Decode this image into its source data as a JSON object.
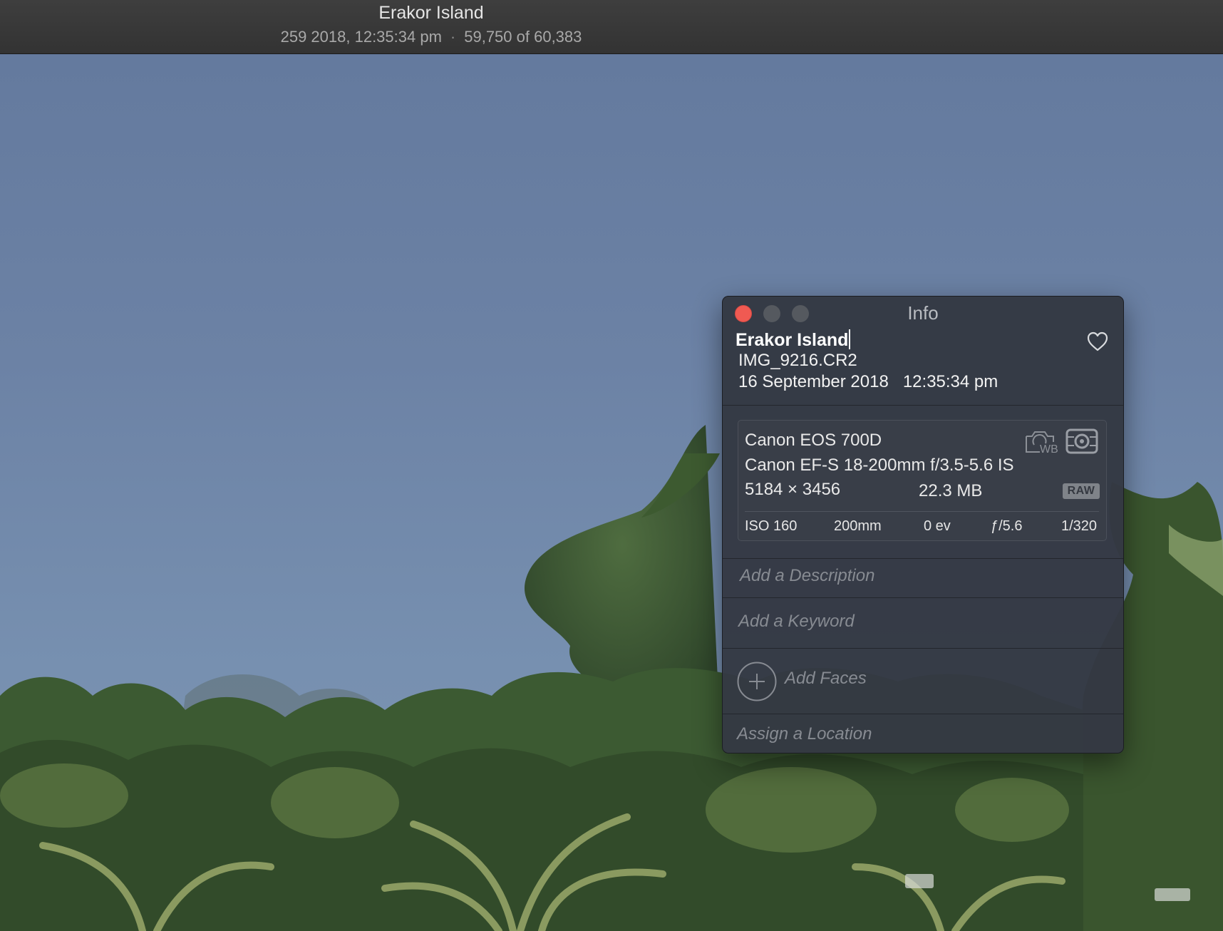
{
  "window": {
    "title": "Erakor Island",
    "subtitle_date": "259 2018, 12:35:34 pm",
    "subtitle_separator": "·",
    "subtitle_position": "59,750 of 60,383"
  },
  "info_panel": {
    "title": "Info",
    "photo_title": "Erakor Island",
    "file_name": "IMG_9216.CR2",
    "date": "16 September 2018",
    "time": "12:35:34 pm",
    "camera": {
      "model": "Canon EOS 700D",
      "lens": "Canon EF-S 18-200mm f/3.5-5.6 IS",
      "dimensions": "5184 × 3456",
      "file_size": "22.3 MB",
      "format_badge": "RAW",
      "wb_label": "WB"
    },
    "exif": {
      "iso": "ISO 160",
      "focal_length": "200mm",
      "exposure_bias": "0 ev",
      "aperture": "ƒ/5.6",
      "shutter": "1/320"
    },
    "description_placeholder": "Add a Description",
    "keyword_placeholder": "Add a Keyword",
    "faces_label": "Add Faces",
    "location_placeholder": "Assign a Location"
  },
  "icons": {
    "favorite": "heart-icon",
    "white_balance": "camera-wb-icon",
    "metering": "metering-icon",
    "add_faces": "plus-circle-icon"
  },
  "colors": {
    "close_button": "#f05a52",
    "inactive_button": "#55595f",
    "panel_background": "#343943",
    "title_bar": "#383838"
  }
}
